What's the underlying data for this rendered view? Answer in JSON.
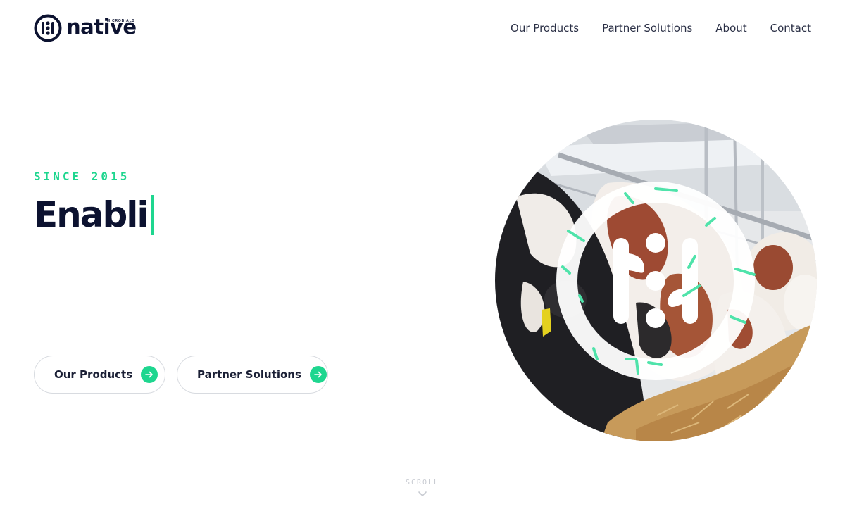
{
  "brand": {
    "name": "native",
    "tagline": "MICROBIALS"
  },
  "nav": [
    {
      "label": "Our Products"
    },
    {
      "label": "Partner Solutions"
    },
    {
      "label": "About"
    },
    {
      "label": "Contact"
    }
  ],
  "hero": {
    "eyebrow": "SINCE 2015",
    "headline_typed": "Enabli",
    "buttons": [
      {
        "label": "Our Products",
        "icon": "arrow-right-icon"
      },
      {
        "label": "Partner Solutions",
        "icon": "arrow-right-icon"
      }
    ],
    "image": {
      "subject": "dairy cows feeding",
      "overlay_icon": "native-logo-mark"
    }
  },
  "scroll": {
    "label": "SCROLL",
    "icon": "chevron-down-icon"
  },
  "colors": {
    "accent": "#1ed68f",
    "text_dark": "#0c1230",
    "border": "#d8dbe0"
  }
}
